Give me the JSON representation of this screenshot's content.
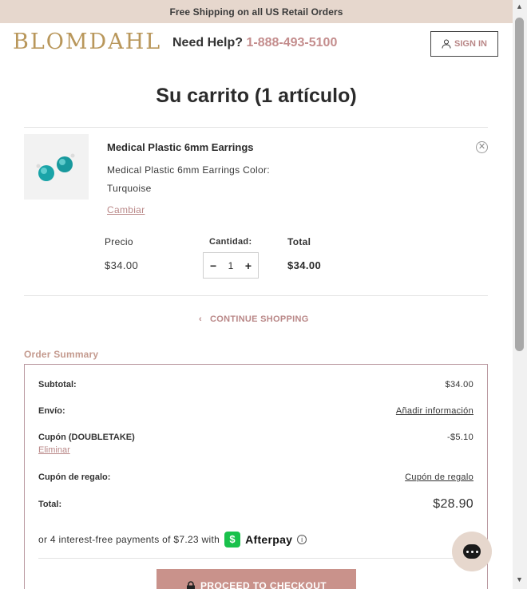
{
  "banner": {
    "text": "Free Shipping on all US Retail Orders"
  },
  "header": {
    "logo": "BLOMDAHL",
    "help_label": "Need Help?",
    "phone": "1-888-493-5100",
    "signin_label": "SIGN IN",
    "signin_icon": "user-icon"
  },
  "cart": {
    "title": "Su carrito (1 artículo)",
    "item": {
      "name": "Medical Plastic 6mm Earrings",
      "description": "Medical Plastic 6mm Earrings Color: Turquoise",
      "change_label": "Cambiar",
      "price_label": "Precio",
      "price": "$34.00",
      "qty_label": "Cantidad:",
      "qty": "1",
      "minus": "−",
      "plus": "+",
      "total_label": "Total",
      "total": "$34.00",
      "image_color": "#1aa4a8"
    },
    "continue_label": "CONTINUE SHOPPING"
  },
  "summary": {
    "title": "Order Summary",
    "subtotal_label": "Subtotal:",
    "subtotal": "$34.00",
    "shipping_label": "Envío:",
    "shipping_link": "Añadir información",
    "coupon_label": "Cupón (DOUBLETAKE)",
    "coupon_value": "-$5.10",
    "coupon_remove": "Eliminar",
    "gift_label": "Cupón de regalo:",
    "gift_link": "Cupón de regalo",
    "total_label": "Total:",
    "total": "$28.90",
    "afterpay_text": "or 4 interest-free payments of $7.23 with",
    "afterpay_brand": "Afterpay",
    "checkout_label": "PROCEED TO CHECKOUT"
  },
  "colors": {
    "brand_gold": "#b9975b",
    "accent_rose": "#c48d8d",
    "banner_bg": "#e6d7cd",
    "afterpay_green": "#19c14b"
  }
}
